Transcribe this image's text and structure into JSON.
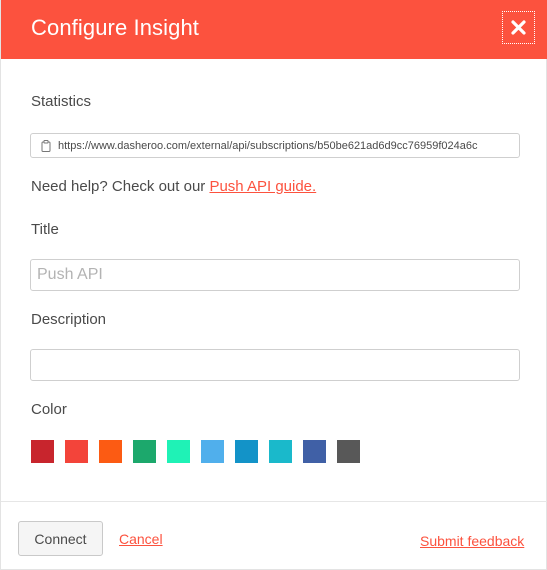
{
  "dialog": {
    "title": "Configure Insight",
    "close_icon": "close-icon"
  },
  "statistics": {
    "label": "Statistics",
    "url": "https://www.dasheroo.com/external/api/subscriptions/b50be621ad6d9cc76959f024a6c",
    "icon": "clipboard-icon"
  },
  "help": {
    "prefix": "Need help? Check out our ",
    "link": "Push API guide."
  },
  "title_field": {
    "label": "Title",
    "placeholder": "Push API",
    "value": ""
  },
  "description_field": {
    "label": "Description",
    "value": ""
  },
  "color": {
    "label": "Color",
    "options": [
      "#c8252d",
      "#f3443a",
      "#fc5b13",
      "#1ca86c",
      "#1ff2b6",
      "#50afec",
      "#1393c8",
      "#1ab9cb",
      "#4060a6",
      "#585858"
    ]
  },
  "footer": {
    "connect_label": "Connect",
    "cancel_label": "Cancel",
    "feedback_label": "Submit feedback"
  },
  "colors": {
    "accent": "#fc523e"
  }
}
